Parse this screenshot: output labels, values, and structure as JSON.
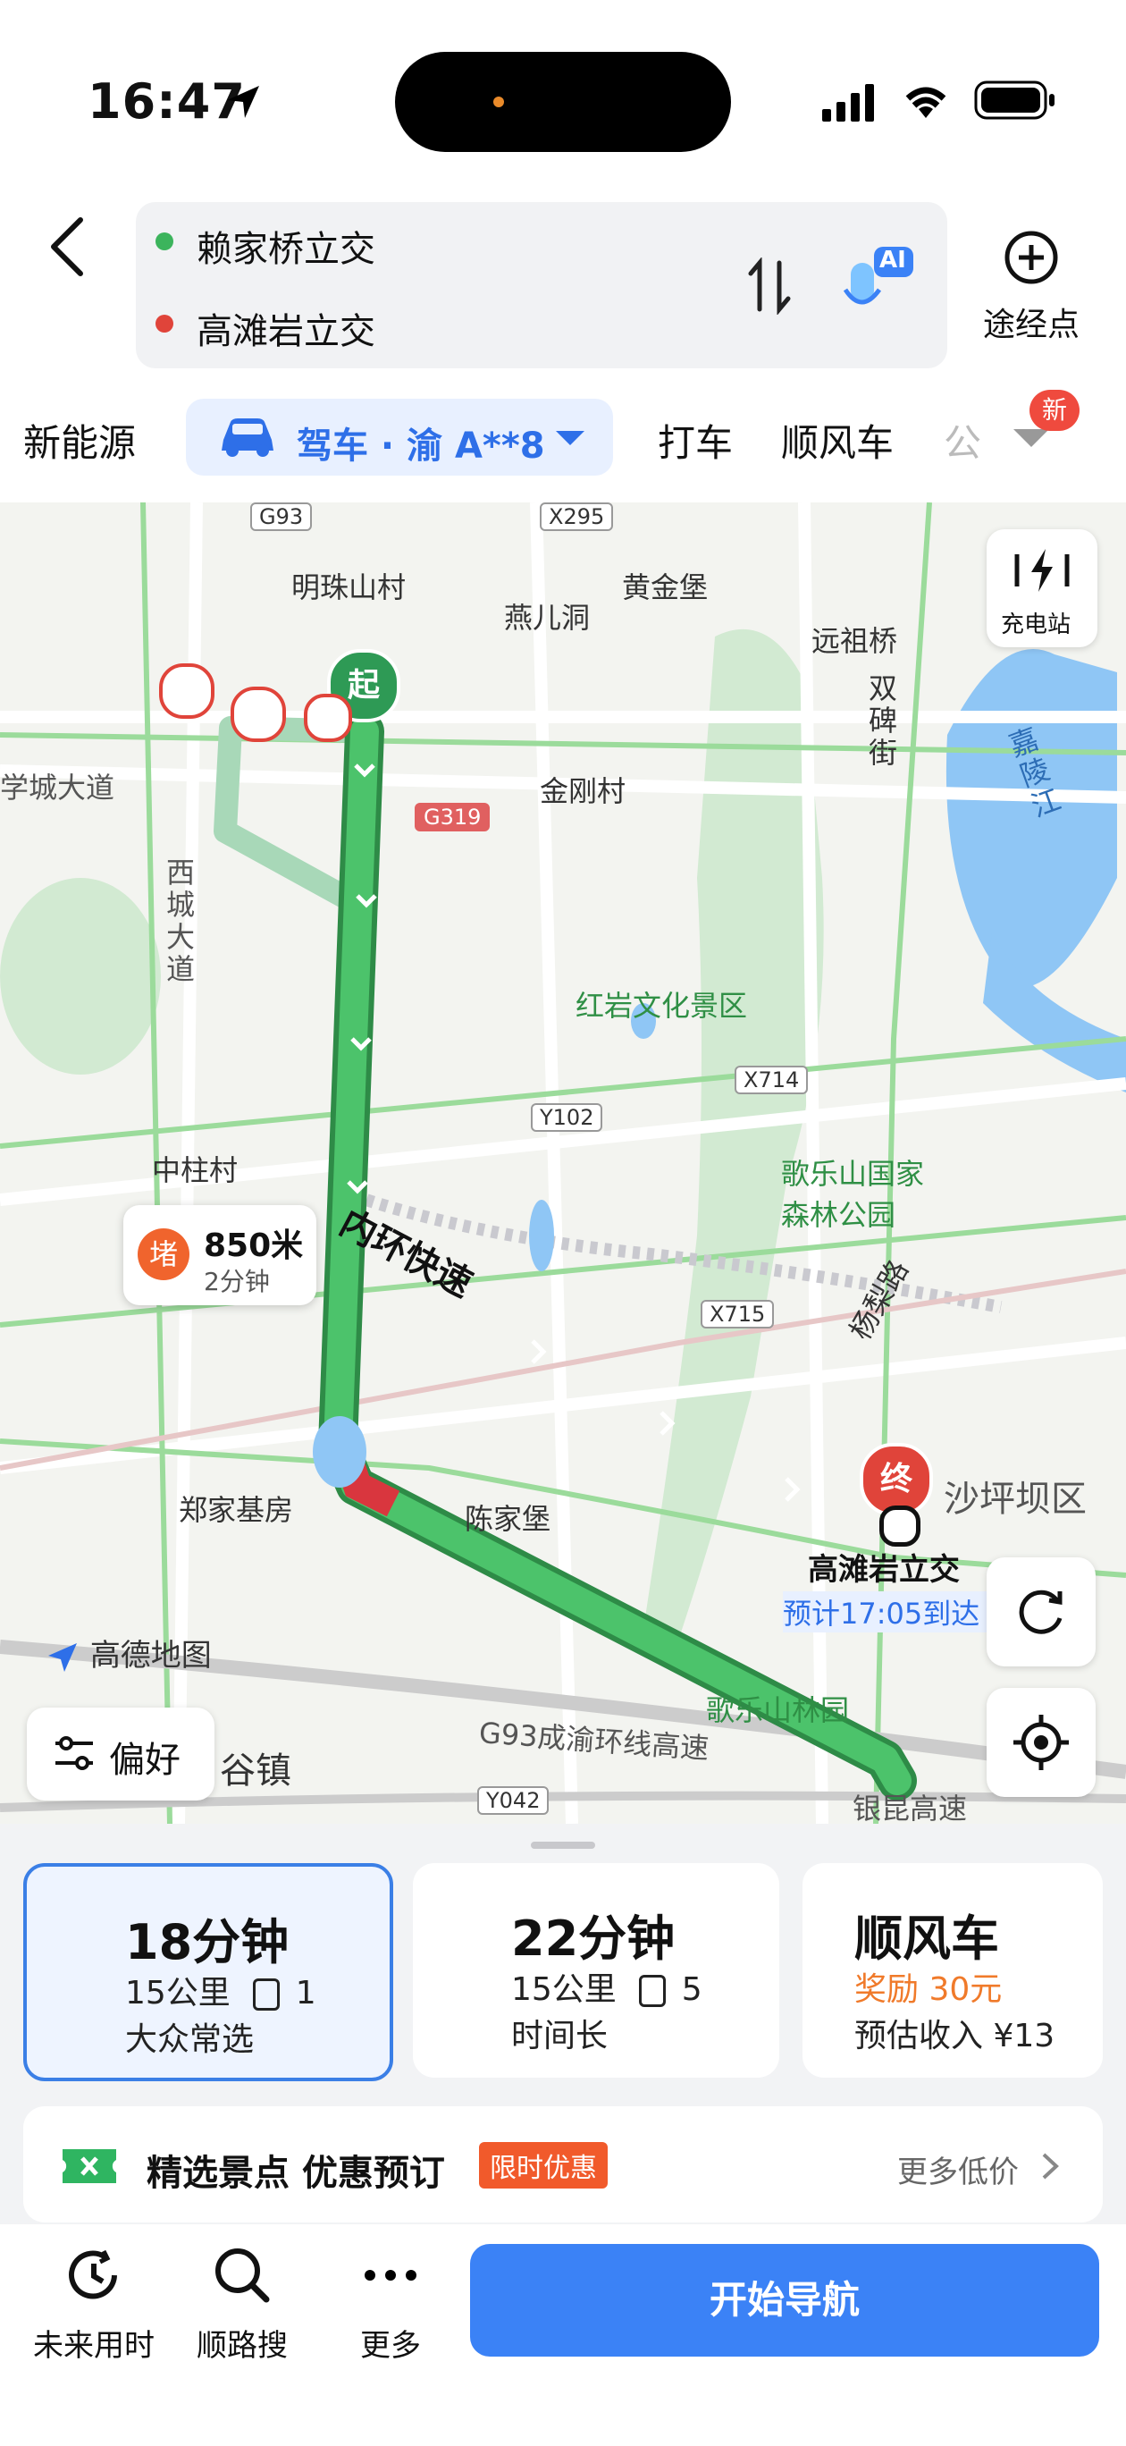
{
  "status_bar": {
    "time": "16:47"
  },
  "header": {
    "origin": "赖家桥立交",
    "destination": "高滩岩立交",
    "ai_badge": "AI",
    "waypoint_label": "途经点"
  },
  "modes": {
    "new_energy": "新能源",
    "drive": "驾车 · 渝 A**8",
    "taxi": "打车",
    "carpool": "顺风车",
    "more_cut": "公",
    "new_badge": "新"
  },
  "map": {
    "labels": {
      "mingzhu": "明珠山村",
      "yanerdong": "燕儿洞",
      "huangjinbao": "黄金堡",
      "yuanzuqiao": "远祖桥",
      "jingangcun": "金刚村",
      "shuangbei": "双碑街",
      "jialingjiang": "嘉陵江",
      "hongyan": "红岩文化景区",
      "gelepark": "歌乐山国家森林公园",
      "zhongzhu": "中柱村",
      "yangli": "杨梨路",
      "zhengjia": "郑家基房",
      "chenjia": "陈家堡",
      "shapingba": "沙坪坝区",
      "gelelin": "歌乐山林园",
      "xicheng": "西城大道",
      "xuecheng": "学城大道",
      "guzhen": "谷镇",
      "chengyu": "G93成渝环线高速",
      "yinkun": "银昆高速",
      "neihuan": "内环快速",
      "gaode": "高德地图",
      "dest_name": "高滩岩立交",
      "eta": "预计17:05到达"
    },
    "road_tags": {
      "g93": "G93",
      "x295": "X295",
      "g319": "G319",
      "x714": "X714",
      "y102": "Y102",
      "x715": "X715",
      "y042": "Y042"
    },
    "start_marker": "起",
    "end_marker": "终",
    "charging_label": "充电站",
    "preference_label": "偏好",
    "traffic": {
      "badge": "堵",
      "distance": "850米",
      "duration": "2分钟"
    }
  },
  "routes": [
    {
      "time": "18分钟",
      "distance": "15公里",
      "lights": "1",
      "tag": "大众常选"
    },
    {
      "time": "22分钟",
      "distance": "15公里",
      "lights": "5",
      "tag": "时间长"
    }
  ],
  "carpool_card": {
    "title": "顺风车",
    "reward": "奖励 30元",
    "income": "预估收入 ¥13"
  },
  "promo": {
    "title": "精选景点 优惠预订",
    "badge": "限时优惠",
    "more": "更多低价"
  },
  "toolbar": {
    "future": "未来用时",
    "search": "顺路搜",
    "more": "更多",
    "start": "开始导航"
  },
  "colors": {
    "accent": "#3b82f6",
    "route_green": "#3cb45c",
    "jam_red": "#d9363e",
    "map_bg": "#f3f4f0"
  }
}
